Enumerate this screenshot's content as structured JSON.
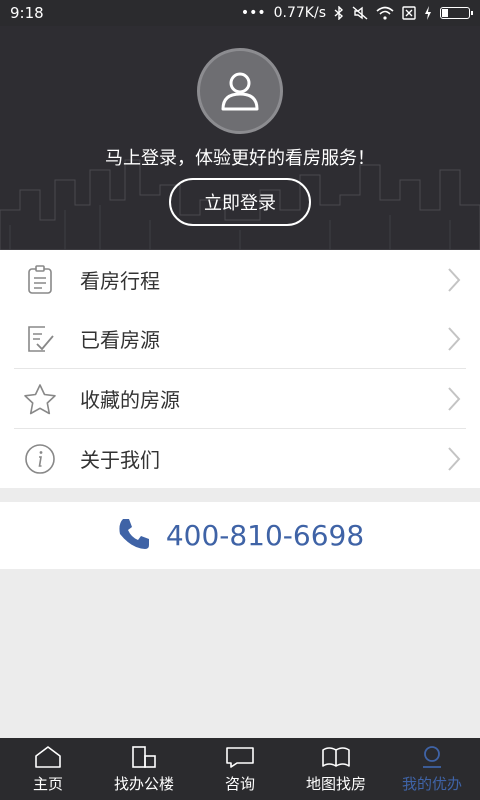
{
  "status_bar": {
    "time": "9:18",
    "dots": "•••",
    "network_speed": "0.77K/s"
  },
  "profile": {
    "login_tip": "马上登录，体验更好的看房服务！",
    "login_button": "立即登录"
  },
  "menu": {
    "items": [
      {
        "label": "看房行程",
        "icon": "clipboard-icon"
      },
      {
        "label": "已看房源",
        "icon": "checklist-icon"
      },
      {
        "label": "收藏的房源",
        "icon": "star-icon"
      },
      {
        "label": "关于我们",
        "icon": "info-icon"
      }
    ]
  },
  "contact": {
    "phone": "400-810-6698",
    "icon": "phone-icon"
  },
  "bottom_nav": {
    "items": [
      {
        "label": "主页",
        "icon": "home-icon"
      },
      {
        "label": "找办公楼",
        "icon": "building-icon"
      },
      {
        "label": "咨询",
        "icon": "message-icon"
      },
      {
        "label": "地图找房",
        "icon": "map-icon"
      },
      {
        "label": "我的优办",
        "icon": "user-icon",
        "active": true
      }
    ]
  },
  "colors": {
    "header_bg": "#2e2d32",
    "accent": "#3f63a6",
    "nav_bg": "#2b2b2e"
  }
}
